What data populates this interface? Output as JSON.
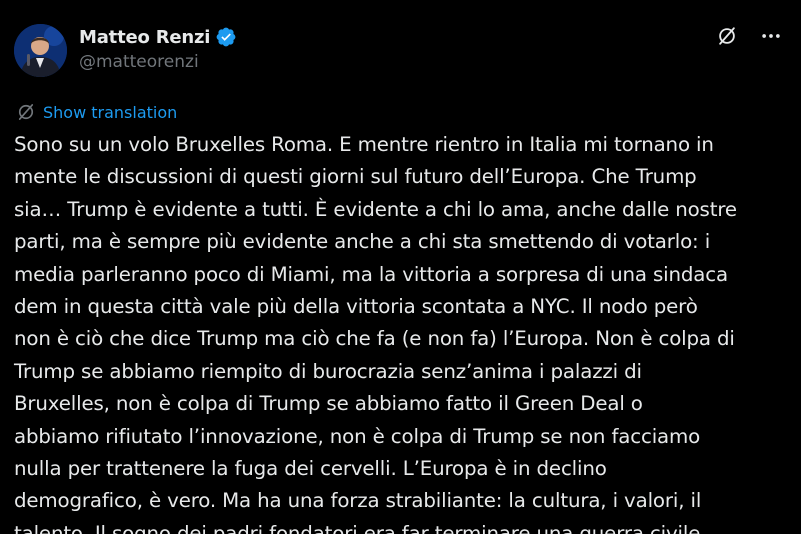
{
  "author": {
    "name": "Matteo Renzi",
    "handle": "@matteorenzi",
    "verified": true,
    "verified_badge_color": "#1d9bf0"
  },
  "actions": {
    "translate_icon": "translate-icon",
    "more_icon": "more-icon"
  },
  "translation": {
    "label": "Show translation",
    "color": "#1d9bf0"
  },
  "tweet": {
    "lines": [
      "Sono su un volo Bruxelles Roma. E mentre rientro in Italia mi tornano in",
      "mente le discussioni di questi giorni sul futuro dell’Europa. Che Trump",
      "sia… Trump è evidente a tutti. È evidente a chi lo ama, anche dalle nostre",
      "parti, ma è sempre più evidente anche a chi sta smettendo di votarlo: i",
      "media parleranno poco di Miami, ma la vittoria a sorpresa di una sindaca",
      "dem in questa città vale più della vittoria scontata a NYC. Il nodo però",
      "non è ciò che dice Trump ma ciò che fa (e non fa) l’Europa. Non è colpa di",
      "Trump se abbiamo riempito di burocrazia senz’anima i palazzi di",
      "Bruxelles, non è colpa di Trump se abbiamo fatto il Green Deal o",
      "abbiamo rifiutato l’innovazione, non è colpa di Trump se non facciamo",
      "nulla per trattenere la fuga dei cervelli. L’Europa è in declino",
      "demografico, è vero. Ma ha una forza strabiliante: la cultura, i valori, il",
      "talento. Il sogno dei padri fondatori era far terminare una guerra civile"
    ]
  },
  "colors": {
    "background": "#000000",
    "text": "#e7e9ea",
    "secondary_text": "#71767b",
    "accent": "#1d9bf0"
  }
}
